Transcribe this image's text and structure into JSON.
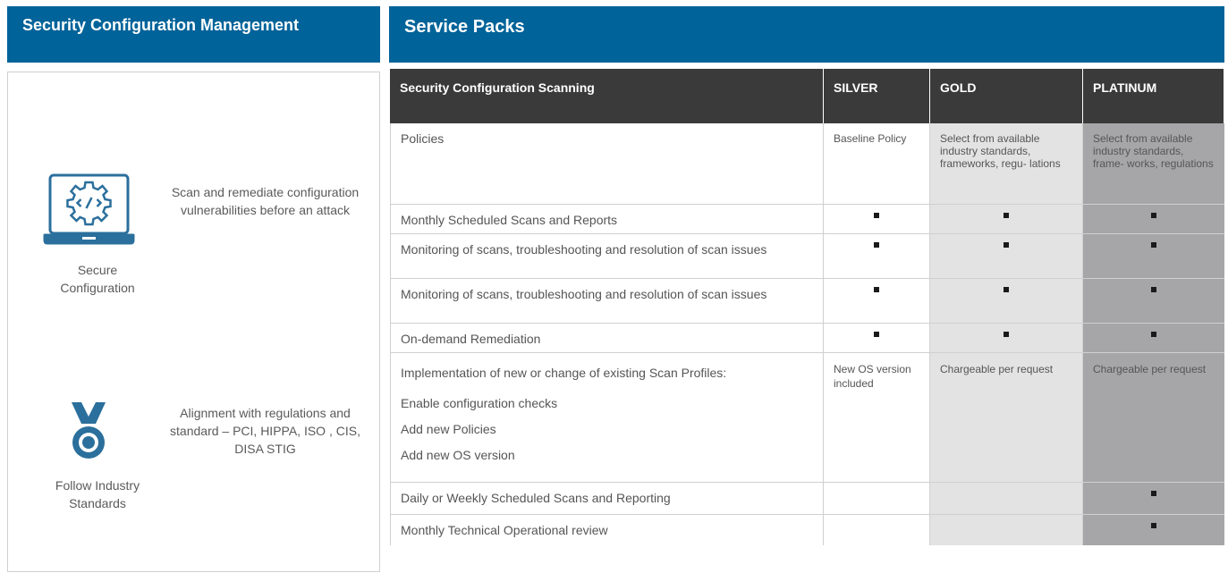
{
  "left_header": {
    "title": "Security Configuration Management"
  },
  "right_header": {
    "title": "Service Packs"
  },
  "features": [
    {
      "icon": "laptop-gear-code-icon",
      "caption": "Secure Configuration",
      "description": "Scan and remediate configuration vulnerabilities before an attack"
    },
    {
      "icon": "medal-icon",
      "caption": "Follow Industry Standards",
      "description": "Alignment with regulations and standard – PCI, HIPPA, ISO , CIS, DISA STIG"
    }
  ],
  "colors": {
    "brand_blue": "#006399",
    "header_dark": "#3a3a3a",
    "gold_bg": "#e3e3e3",
    "platinum_bg": "#a6a6a8",
    "icon_blue": "#2b6f9c"
  },
  "table": {
    "headers": [
      "Security Configuration Scanning",
      "SILVER",
      "GOLD",
      "PLATINUM"
    ],
    "rows": [
      {
        "feature": "Policies",
        "silver": "Baseline Policy",
        "gold": "Select from available industry standards, frameworks, regu- lations",
        "platinum": "Select from available industry standards, frame- works, regulations"
      },
      {
        "feature": "Monthly Scheduled Scans and Reports",
        "silver": "■",
        "gold": "■",
        "platinum": "■"
      },
      {
        "feature": "Monitoring of scans, troubleshooting and resolution of scan issues",
        "silver": "■",
        "gold": "■",
        "platinum": "■"
      },
      {
        "feature": "Monitoring of scans, troubleshooting and resolution of scan issues",
        "silver": "■",
        "gold": "■",
        "platinum": "■"
      },
      {
        "feature": "On-demand Remediation",
        "silver": "■",
        "gold": "■",
        "platinum": "■"
      },
      {
        "feature": "Implementation of new or change of existing Scan Profiles:",
        "sub_items": [
          "Enable configuration checks",
          "Add new Policies",
          "Add new OS version"
        ],
        "silver": "New OS version included",
        "gold": "Chargeable per request",
        "platinum": "Chargeable per request"
      },
      {
        "feature": "Daily or Weekly Scheduled Scans and Reporting",
        "silver": "",
        "gold": "",
        "platinum": "■"
      },
      {
        "feature": "Monthly Technical Operational review",
        "silver": "",
        "gold": "",
        "platinum": "■"
      }
    ]
  }
}
